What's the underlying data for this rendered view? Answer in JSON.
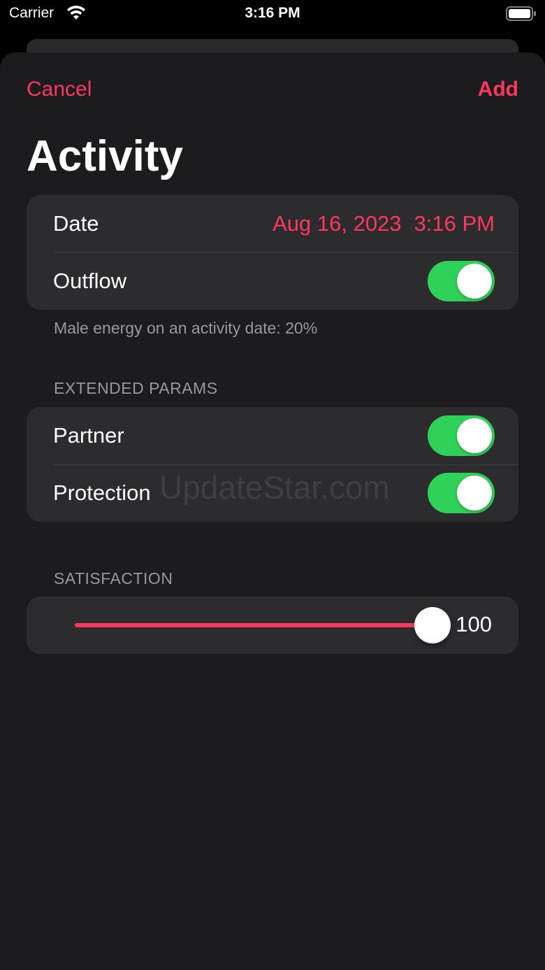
{
  "status_bar": {
    "carrier": "Carrier",
    "time": "3:16 PM",
    "wifi_icon": "wifi-icon",
    "battery_icon": "battery-icon"
  },
  "nav": {
    "cancel_label": "Cancel",
    "add_label": "Add"
  },
  "title": "Activity",
  "main_group": {
    "date_label": "Date",
    "date_value": "Aug 16, 2023",
    "time_value": "3:16 PM",
    "outflow_label": "Outflow",
    "outflow_on": true
  },
  "footnote": "Male energy on an activity date: 20%",
  "extended": {
    "header": "EXTENDED PARAMS",
    "partner_label": "Partner",
    "partner_on": true,
    "protection_label": "Protection",
    "protection_on": true
  },
  "watermark": "UpdateStar.com",
  "satisfaction": {
    "header": "SATISFACTION",
    "value": 100,
    "value_label": "100",
    "min": 0,
    "max": 100
  },
  "colors": {
    "accent": "#ff375f",
    "toggle_on": "#30d158",
    "background": "#1c1c1e",
    "group_background": "#2c2c2e",
    "secondary_text": "#98989f"
  }
}
